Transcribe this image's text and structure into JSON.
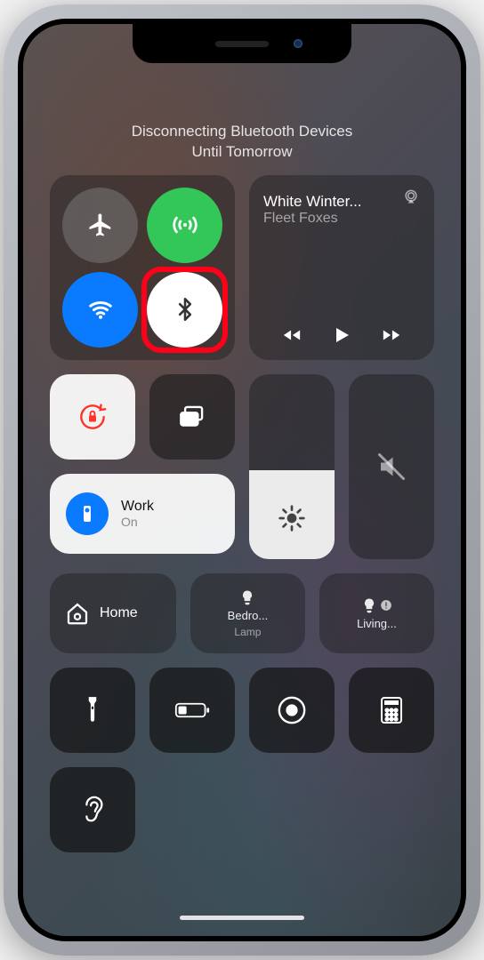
{
  "status_line1": "Disconnecting Bluetooth Devices",
  "status_line2": "Until Tomorrow",
  "now_playing": {
    "title": "White Winter...",
    "artist": "Fleet Foxes"
  },
  "focus": {
    "label": "Work",
    "sub": "On"
  },
  "home": {
    "label": "Home"
  },
  "accessory1": {
    "label": "Bedro...",
    "sub": "Lamp"
  },
  "accessory2": {
    "label": "Living..."
  },
  "brightness_pct": 48
}
